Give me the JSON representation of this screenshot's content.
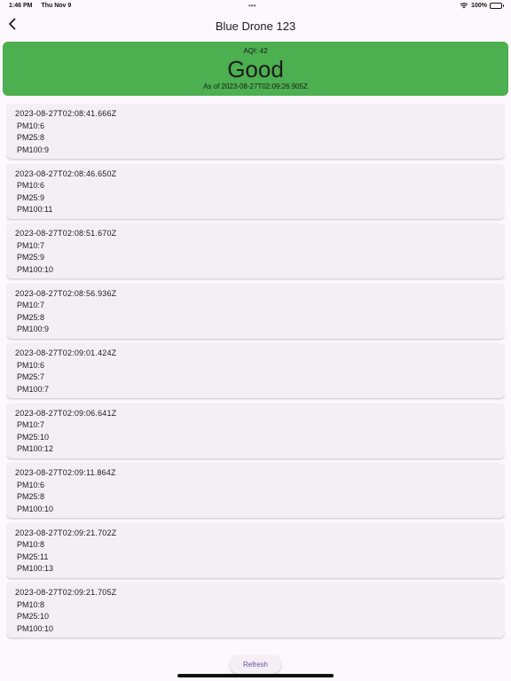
{
  "status_bar": {
    "time": "1:46 PM",
    "date": "Thu Nov 9",
    "dots": "•••",
    "battery_percent": "100%"
  },
  "header": {
    "title": "Blue Drone 123",
    "back_icon": "chevron-left-icon"
  },
  "aqi": {
    "value_text": "AQI: 42",
    "status": "Good",
    "as_of": "As of  2023-08-27T02:09:26.905Z",
    "color": "#4caf50"
  },
  "readings": [
    {
      "time": "2023-08-27T02:08:41.666Z",
      "pm10": "PM10:6",
      "pm25": "PM25:8",
      "pm100": "PM100:9"
    },
    {
      "time": "2023-08-27T02:08:46.650Z",
      "pm10": "PM10:6",
      "pm25": "PM25:9",
      "pm100": "PM100:11"
    },
    {
      "time": "2023-08-27T02:08:51.670Z",
      "pm10": "PM10:7",
      "pm25": "PM25:9",
      "pm100": "PM100:10"
    },
    {
      "time": "2023-08-27T02:08:56.936Z",
      "pm10": "PM10:7",
      "pm25": "PM25:8",
      "pm100": "PM100:9"
    },
    {
      "time": "2023-08-27T02:09:01.424Z",
      "pm10": "PM10:6",
      "pm25": "PM25:7",
      "pm100": "PM100:7"
    },
    {
      "time": "2023-08-27T02:09:06.641Z",
      "pm10": "PM10:7",
      "pm25": "PM25:10",
      "pm100": "PM100:12"
    },
    {
      "time": "2023-08-27T02:09:11.864Z",
      "pm10": "PM10:6",
      "pm25": "PM25:8",
      "pm100": "PM100:10"
    },
    {
      "time": "2023-08-27T02:09:21.702Z",
      "pm10": "PM10:8",
      "pm25": "PM25:11",
      "pm100": "PM100:13"
    },
    {
      "time": "2023-08-27T02:09:21.705Z",
      "pm10": "PM10:8",
      "pm25": "PM25:10",
      "pm100": "PM100:10"
    }
  ],
  "footer": {
    "refresh_label": "Refresh"
  }
}
